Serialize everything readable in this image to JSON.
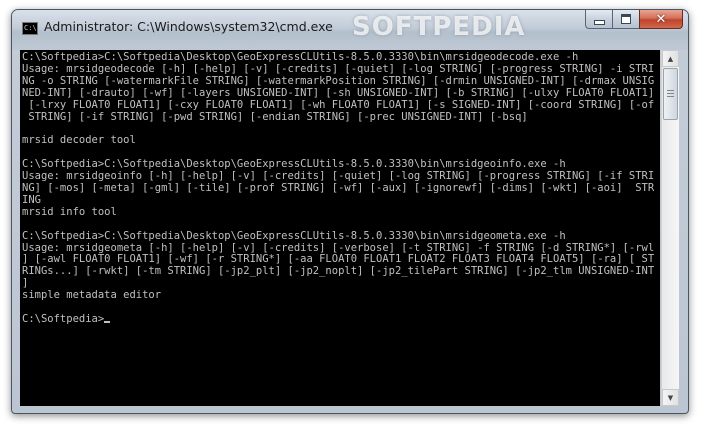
{
  "window": {
    "title": "Administrator: C:\\Windows\\system32\\cmd.exe",
    "watermark": "SOFTPEDIA",
    "icon": "cmd-icon"
  },
  "caption_buttons": {
    "minimize_icon": "minimize-icon",
    "maximize_icon": "maximize-icon",
    "close_icon": "close-icon",
    "close_glyph": "✕"
  },
  "console": {
    "text": "C:\\Softpedia>C:\\Softpedia\\Desktop\\GeoExpressCLUtils-8.5.0.3330\\bin\\mrsidgeodecode.exe -h\nUsage: mrsidgeodecode [-h] [-help] [-v] [-credits] [-quiet] [-log STRING] [-progress STRING] -i STRING -o STRING [-watermarkFile STRING] [-watermarkPosition STRING] [-drmin UNSIGNED-INT] [-drmax UNSIGNED-INT] [-drauto] [-wf] [-layers UNSIGNED-INT] [-sh UNSIGNED-INT] [-b STRING] [-ulxy FLOAT0 FLOAT1] [-lrxy FLOAT0 FLOAT1] [-cxy FLOAT0 FLOAT1] [-wh FLOAT0 FLOAT1] [-s SIGNED-INT] [-coord STRING] [-of STRING] [-if STRING] [-pwd STRING] [-endian STRING] [-prec UNSIGNED-INT] [-bsq]\n\nmrsid decoder tool\n\nC:\\Softpedia>C:\\Softpedia\\Desktop\\GeoExpressCLUtils-8.5.0.3330\\bin\\mrsidgeoinfo.exe -h\nUsage: mrsidgeoinfo [-h] [-help] [-v] [-credits] [-quiet] [-log STRING] [-progress STRING] [-if STRING] [-mos] [-meta] [-gml] [-tile] [-prof STRING] [-wf] [-aux] [-ignorewf] [-dims] [-wkt] [-aoi]  STRING\nmrsid info tool\n\nC:\\Softpedia>C:\\Softpedia\\Desktop\\GeoExpressCLUtils-8.5.0.3330\\bin\\mrsidgeometa.exe -h\nUsage: mrsidgeometa [-h] [-help] [-v] [-credits] [-verbose] [-t STRING] -f STRING [-d STRING*] [-rwl] [-awl FLOAT0 FLOAT1] [-wf] [-r STRING*] [-aa FLOAT0 FLOAT1 FLOAT2 FLOAT3 FLOAT4 FLOAT5] [-ra] [ STRINGs...] [-rwkt] [-tm STRING] [-jp2_plt] [-jp2_noplt] [-jp2_tilePart STRING] [-jp2_tlm UNSIGNED-INT]\nsimple metadata editor\n\nC:\\Softpedia>"
  },
  "scrollbar": {
    "up_icon": "scroll-up-arrow-icon",
    "down_icon": "scroll-down-arrow-icon"
  },
  "colors": {
    "console_background": "#000000",
    "console_text": "#c0c0c0",
    "close_button": "#c0432a"
  }
}
